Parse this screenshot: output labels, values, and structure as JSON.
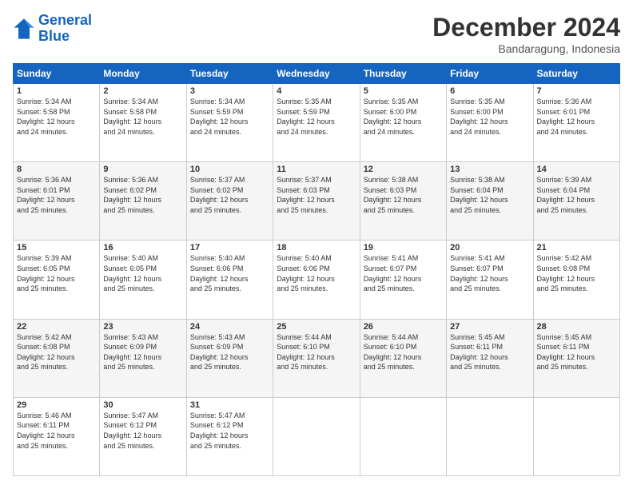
{
  "logo": {
    "line1": "General",
    "line2": "Blue"
  },
  "title": "December 2024",
  "location": "Bandaragung, Indonesia",
  "days_of_week": [
    "Sunday",
    "Monday",
    "Tuesday",
    "Wednesday",
    "Thursday",
    "Friday",
    "Saturday"
  ],
  "weeks": [
    [
      {
        "day": "1",
        "info": "Sunrise: 5:34 AM\nSunset: 5:58 PM\nDaylight: 12 hours\nand 24 minutes."
      },
      {
        "day": "2",
        "info": "Sunrise: 5:34 AM\nSunset: 5:58 PM\nDaylight: 12 hours\nand 24 minutes."
      },
      {
        "day": "3",
        "info": "Sunrise: 5:34 AM\nSunset: 5:59 PM\nDaylight: 12 hours\nand 24 minutes."
      },
      {
        "day": "4",
        "info": "Sunrise: 5:35 AM\nSunset: 5:59 PM\nDaylight: 12 hours\nand 24 minutes."
      },
      {
        "day": "5",
        "info": "Sunrise: 5:35 AM\nSunset: 6:00 PM\nDaylight: 12 hours\nand 24 minutes."
      },
      {
        "day": "6",
        "info": "Sunrise: 5:35 AM\nSunset: 6:00 PM\nDaylight: 12 hours\nand 24 minutes."
      },
      {
        "day": "7",
        "info": "Sunrise: 5:36 AM\nSunset: 6:01 PM\nDaylight: 12 hours\nand 24 minutes."
      }
    ],
    [
      {
        "day": "8",
        "info": "Sunrise: 5:36 AM\nSunset: 6:01 PM\nDaylight: 12 hours\nand 25 minutes."
      },
      {
        "day": "9",
        "info": "Sunrise: 5:36 AM\nSunset: 6:02 PM\nDaylight: 12 hours\nand 25 minutes."
      },
      {
        "day": "10",
        "info": "Sunrise: 5:37 AM\nSunset: 6:02 PM\nDaylight: 12 hours\nand 25 minutes."
      },
      {
        "day": "11",
        "info": "Sunrise: 5:37 AM\nSunset: 6:03 PM\nDaylight: 12 hours\nand 25 minutes."
      },
      {
        "day": "12",
        "info": "Sunrise: 5:38 AM\nSunset: 6:03 PM\nDaylight: 12 hours\nand 25 minutes."
      },
      {
        "day": "13",
        "info": "Sunrise: 5:38 AM\nSunset: 6:04 PM\nDaylight: 12 hours\nand 25 minutes."
      },
      {
        "day": "14",
        "info": "Sunrise: 5:39 AM\nSunset: 6:04 PM\nDaylight: 12 hours\nand 25 minutes."
      }
    ],
    [
      {
        "day": "15",
        "info": "Sunrise: 5:39 AM\nSunset: 6:05 PM\nDaylight: 12 hours\nand 25 minutes."
      },
      {
        "day": "16",
        "info": "Sunrise: 5:40 AM\nSunset: 6:05 PM\nDaylight: 12 hours\nand 25 minutes."
      },
      {
        "day": "17",
        "info": "Sunrise: 5:40 AM\nSunset: 6:06 PM\nDaylight: 12 hours\nand 25 minutes."
      },
      {
        "day": "18",
        "info": "Sunrise: 5:40 AM\nSunset: 6:06 PM\nDaylight: 12 hours\nand 25 minutes."
      },
      {
        "day": "19",
        "info": "Sunrise: 5:41 AM\nSunset: 6:07 PM\nDaylight: 12 hours\nand 25 minutes."
      },
      {
        "day": "20",
        "info": "Sunrise: 5:41 AM\nSunset: 6:07 PM\nDaylight: 12 hours\nand 25 minutes."
      },
      {
        "day": "21",
        "info": "Sunrise: 5:42 AM\nSunset: 6:08 PM\nDaylight: 12 hours\nand 25 minutes."
      }
    ],
    [
      {
        "day": "22",
        "info": "Sunrise: 5:42 AM\nSunset: 6:08 PM\nDaylight: 12 hours\nand 25 minutes."
      },
      {
        "day": "23",
        "info": "Sunrise: 5:43 AM\nSunset: 6:09 PM\nDaylight: 12 hours\nand 25 minutes."
      },
      {
        "day": "24",
        "info": "Sunrise: 5:43 AM\nSunset: 6:09 PM\nDaylight: 12 hours\nand 25 minutes."
      },
      {
        "day": "25",
        "info": "Sunrise: 5:44 AM\nSunset: 6:10 PM\nDaylight: 12 hours\nand 25 minutes."
      },
      {
        "day": "26",
        "info": "Sunrise: 5:44 AM\nSunset: 6:10 PM\nDaylight: 12 hours\nand 25 minutes."
      },
      {
        "day": "27",
        "info": "Sunrise: 5:45 AM\nSunset: 6:11 PM\nDaylight: 12 hours\nand 25 minutes."
      },
      {
        "day": "28",
        "info": "Sunrise: 5:45 AM\nSunset: 6:11 PM\nDaylight: 12 hours\nand 25 minutes."
      }
    ],
    [
      {
        "day": "29",
        "info": "Sunrise: 5:46 AM\nSunset: 6:11 PM\nDaylight: 12 hours\nand 25 minutes."
      },
      {
        "day": "30",
        "info": "Sunrise: 5:47 AM\nSunset: 6:12 PM\nDaylight: 12 hours\nand 25 minutes."
      },
      {
        "day": "31",
        "info": "Sunrise: 5:47 AM\nSunset: 6:12 PM\nDaylight: 12 hours\nand 25 minutes."
      },
      {
        "day": "",
        "info": ""
      },
      {
        "day": "",
        "info": ""
      },
      {
        "day": "",
        "info": ""
      },
      {
        "day": "",
        "info": ""
      }
    ]
  ]
}
